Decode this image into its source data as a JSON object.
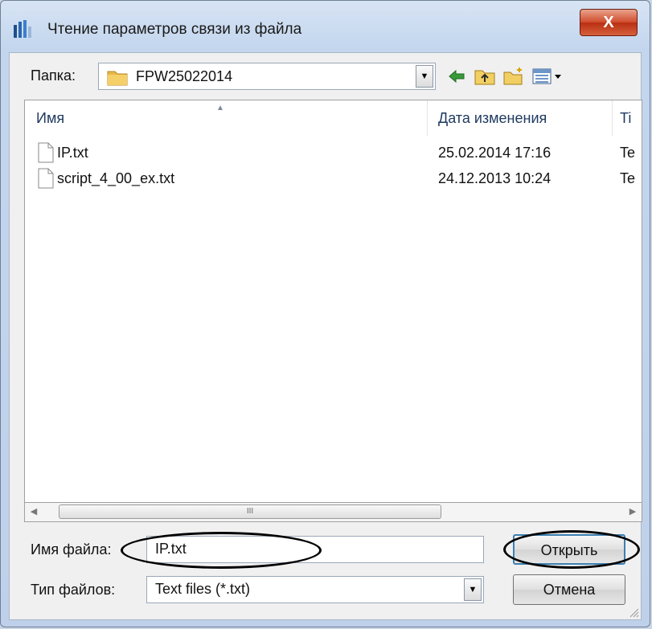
{
  "window": {
    "title": "Чтение параметров связи из файла",
    "close_label": "X"
  },
  "folder": {
    "label": "Папка:",
    "value": "FPW25022014"
  },
  "toolbar": {
    "icons": [
      "back-arrow-icon",
      "up-folder-icon",
      "new-folder-icon",
      "view-menu-icon"
    ]
  },
  "list": {
    "columns": {
      "name": "Имя",
      "date": "Дата изменения",
      "type": "Ti"
    },
    "files": [
      {
        "name": "IP.txt",
        "date": "25.02.2014 17:16",
        "type": "Te"
      },
      {
        "name": "script_4_00_ex.txt",
        "date": "24.12.2013 10:24",
        "type": "Te"
      }
    ],
    "scroll_thumb_label": "III"
  },
  "filename": {
    "label": "Имя файла:",
    "value": "IP.txt"
  },
  "filetype": {
    "label": "Тип файлов:",
    "value": "Text files (*.txt)"
  },
  "buttons": {
    "open": "Открыть",
    "cancel": "Отмена"
  },
  "colors": {
    "accent": "#3c7fb1",
    "close": "#c8472a"
  }
}
